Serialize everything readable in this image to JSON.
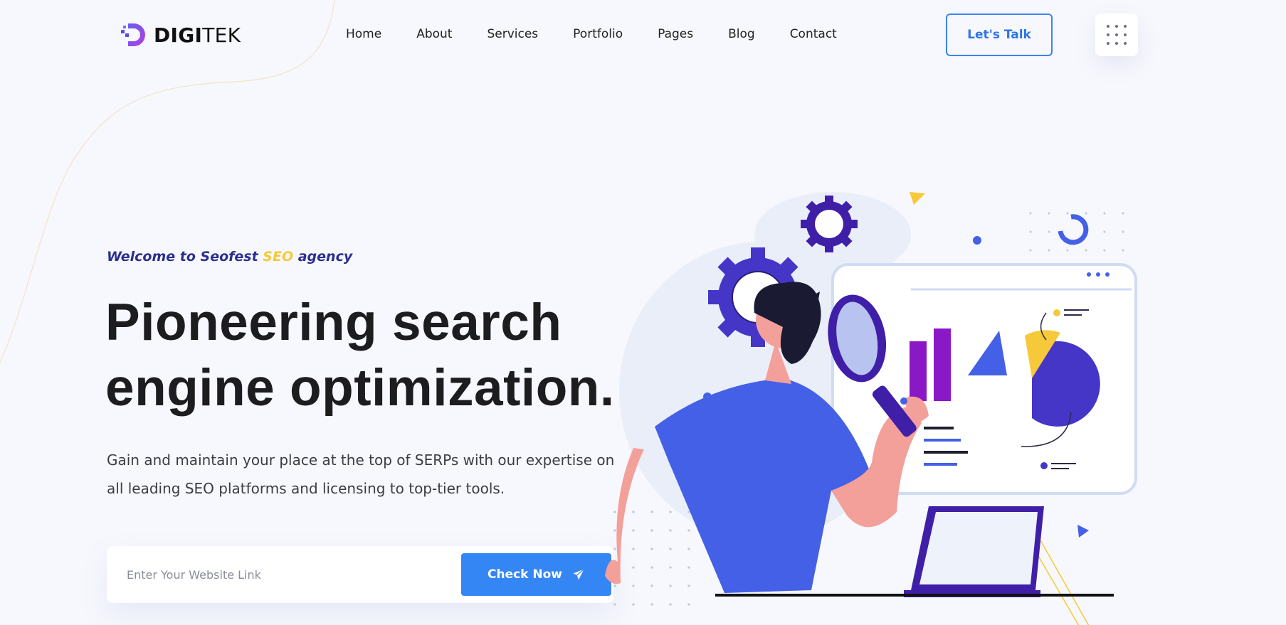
{
  "brand": {
    "name_bold": "DIGI",
    "name_light": "TEK",
    "accent": "#4a3bd4"
  },
  "nav": {
    "items": [
      {
        "label": "Home"
      },
      {
        "label": "About"
      },
      {
        "label": "Services"
      },
      {
        "label": "Portfolio"
      },
      {
        "label": "Pages"
      },
      {
        "label": "Blog"
      },
      {
        "label": "Contact"
      }
    ]
  },
  "header": {
    "cta_label": "Let's Talk",
    "menu_icon": "grid-dots-icon"
  },
  "hero": {
    "tagline_pre": "Welcome to Seofest ",
    "tagline_highlight": "SEO",
    "tagline_post": " agency",
    "headline_line1": "Pioneering search",
    "headline_line2": "engine optimization.",
    "description": "Gain and maintain your place at the top of SERPs with our expertise on all leading SEO platforms and licensing to top-tier tools.",
    "search": {
      "placeholder": "Enter Your Website Link",
      "value": ""
    },
    "submit_label": "Check Now",
    "submit_icon": "paper-plane-icon"
  },
  "colors": {
    "primary": "#3586f5",
    "headline": "#1d1d1f",
    "tagline": "#2b2f8f",
    "highlight": "#f5c93a",
    "background": "#f7f8fd"
  }
}
